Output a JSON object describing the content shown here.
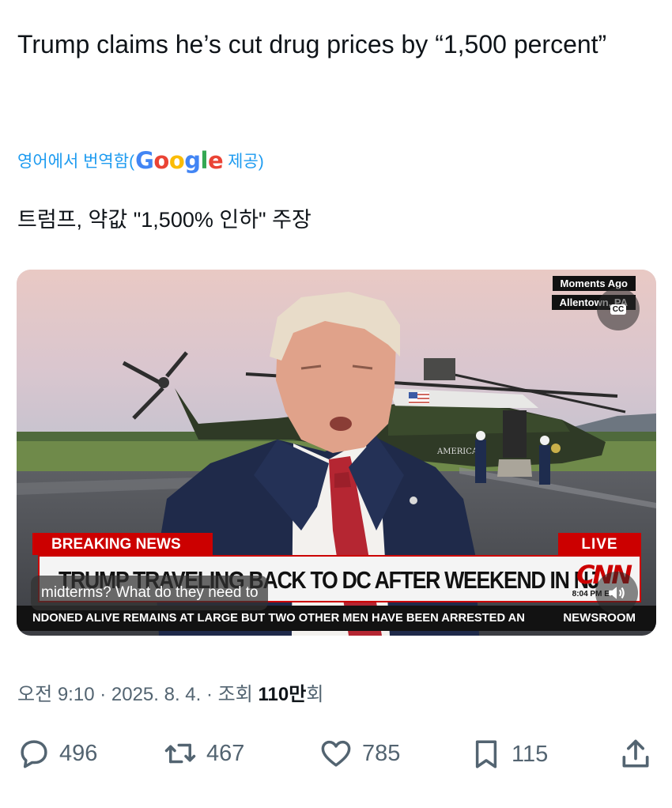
{
  "tweet": {
    "text": "Trump claims he’s cut drug prices by “1,500 percent”",
    "translate_prefix": "영어에서 번역함(",
    "translate_brand": "Google",
    "translate_suffix": " 제공)",
    "translated_text": "트럼프, 약값 \"1,500% 인하\" 주장"
  },
  "video": {
    "time_tag": "Moments Ago",
    "location_tag": "Allentown, PA",
    "cc_label": "CC",
    "breaking_label": "BREAKING NEWS",
    "live_label": "LIVE",
    "headline": "TRUMP TRAVELING BACK TO DC AFTER WEEKEND IN NJ",
    "network_logo": "CNN",
    "banner_time": "8:04 PM ET",
    "caption": "midterms? What do they need to",
    "ticker": "NDONED ALIVE REMAINS AT LARGE BUT TWO OTHER MEN HAVE BEEN ARRESTED AN",
    "ticker_tag": "NEWSROOM",
    "helicopter_text": "AMERICA"
  },
  "meta": {
    "time": "오전 9:10",
    "date": "2025. 8. 4.",
    "views_label": "조회",
    "views_count": "110만",
    "views_suffix": "회"
  },
  "actions": {
    "replies": "496",
    "reposts": "467",
    "likes": "785",
    "bookmarks": "115"
  },
  "colors": {
    "link_blue": "#1d9bf0",
    "text_primary": "#0f1419",
    "text_secondary": "#536471",
    "cnn_red": "#cc0000"
  },
  "icons": [
    "reply-icon",
    "repost-icon",
    "like-icon",
    "bookmark-icon",
    "share-icon",
    "closed-captions-icon",
    "volume-icon"
  ]
}
